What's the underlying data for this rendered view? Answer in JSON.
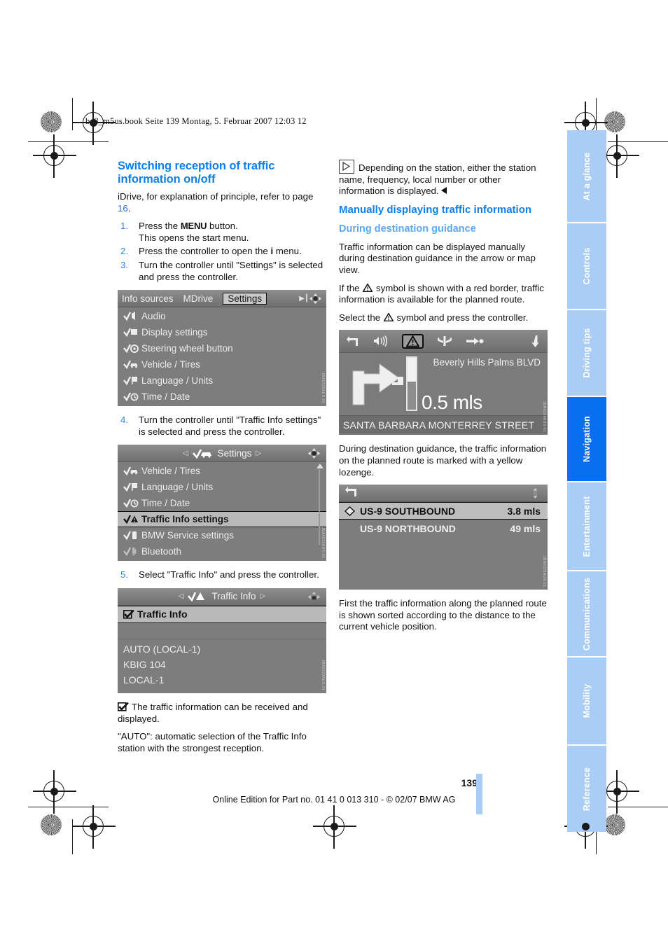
{
  "header": {
    "run_head": "ba8_m5us.book  Seite 139  Montag, 5. Februar 2007  12:03 12"
  },
  "left_column": {
    "section_title": "Switching reception of traffic information on/off",
    "intro_pre": "iDrive, for explanation of principle, refer to page ",
    "intro_link": "16",
    "intro_post": ".",
    "steps": [
      {
        "num": "1.",
        "pre": "Press the ",
        "emph": "MENU",
        "post": " button.",
        "line2": "This opens the start menu."
      },
      {
        "num": "2.",
        "pre": "Press the controller to open the ",
        "emph": "i",
        "post": " menu.",
        "line2": ""
      },
      {
        "num": "3.",
        "pre": "Turn the controller until \"Settings\" is selected and press the controller.",
        "emph": "",
        "post": "",
        "line2": ""
      }
    ],
    "step4": {
      "num": "4.",
      "text": "Turn the controller until \"Traffic Info settings\" is selected and press the controller."
    },
    "step5": {
      "num": "5.",
      "text": "Select \"Traffic Info\" and press the controller."
    },
    "note_checkbox": "The traffic information can be received and displayed.",
    "note_auto": "\"AUTO\": automatic selection of the Traffic Info station with the strongest reception."
  },
  "right_column": {
    "note_play": "Depending on the station, either the station name, frequency, local number or other information is displayed.",
    "heading_manual": "Manually displaying traffic information",
    "heading_during": "During destination guidance",
    "para_1": "Traffic information can be displayed manually during destination guidance in the arrow or map view.",
    "para_2_a": "If the ",
    "para_2_b": " symbol is shown with a red border, traffic information is available for the planned route.",
    "para_3_a": "Select the ",
    "para_3_b": " symbol and press the controller.",
    "para_4": "During destination guidance, the traffic information on the planned route is marked with a yellow lozenge.",
    "para_5": "First the traffic information along the planned route is shown sorted according to the distance to the current vehicle position."
  },
  "screenshot_settings_menu": {
    "tabs": [
      {
        "label": "Info sources",
        "selected": false
      },
      {
        "label": "MDrive",
        "selected": false
      },
      {
        "label": "Settings",
        "selected": true
      }
    ],
    "items": [
      {
        "label": "Audio",
        "icon": "audio-icon"
      },
      {
        "label": "Display settings",
        "icon": "display-icon"
      },
      {
        "label": "Steering wheel button",
        "icon": "steering-wheel-icon"
      },
      {
        "label": "Vehicle / Tires",
        "icon": "vehicle-icon"
      },
      {
        "label": "Language / Units",
        "icon": "language-icon"
      },
      {
        "label": "Time / Date",
        "icon": "clock-icon"
      }
    ],
    "code": "JBA0021AUS-01"
  },
  "screenshot_settings_traffic": {
    "title": "Settings",
    "items": [
      {
        "label": "Vehicle / Tires",
        "selected": false
      },
      {
        "label": "Language / Units",
        "selected": false
      },
      {
        "label": "Time / Date",
        "selected": false
      },
      {
        "label": "Traffic Info settings",
        "selected": true
      },
      {
        "label": "BMW Service settings",
        "selected": false
      },
      {
        "label": "Bluetooth",
        "selected": false
      }
    ],
    "code": "JBA0022AUS-01"
  },
  "screenshot_traffic_info": {
    "title": "Traffic Info",
    "checkbox_label": "Traffic Info",
    "stations": [
      "AUTO (LOCAL-1)",
      "KBIG 104",
      "LOCAL-1"
    ],
    "code": "JBA0023AUS-01"
  },
  "screenshot_arrow_view": {
    "icons": [
      "back-icon",
      "volume-icon",
      "traffic-warning-icon",
      "highway-icon",
      "destination-icon",
      "down-arrow-icon"
    ],
    "street_next": "Beverly Hills Palms BLVD",
    "distance": "0.5 mls",
    "street_current": "SANTA BARBARA MONTERREY STREET",
    "code": "JBA0024AUS-01"
  },
  "screenshot_traffic_list": {
    "rows": [
      {
        "name": "US-9 SOUTHBOUND",
        "distance": "3.8 mls",
        "selected": true
      },
      {
        "name": "US-9 NORTHBOUND",
        "distance": "49 mls",
        "selected": false
      }
    ],
    "code": "JBA0025AUS-01"
  },
  "side_tabs": [
    {
      "label": "At a glance",
      "active": false
    },
    {
      "label": "Controls",
      "active": false
    },
    {
      "label": "Driving tips",
      "active": false
    },
    {
      "label": "Navigation",
      "active": true
    },
    {
      "label": "Entertainment",
      "active": false
    },
    {
      "label": "Communications",
      "active": false
    },
    {
      "label": "Mobility",
      "active": false
    },
    {
      "label": "Reference",
      "active": false
    }
  ],
  "footer": {
    "page_number": "139",
    "imprint": "Online Edition for Part no. 01 41 0 013 310 - © 02/07 BMW AG"
  },
  "colors": {
    "accent_blue": "#0f7fe8",
    "tab_light": "#a9cdf5",
    "tab_active": "#0a6ef0",
    "link_blue": "#2b6fe0"
  }
}
